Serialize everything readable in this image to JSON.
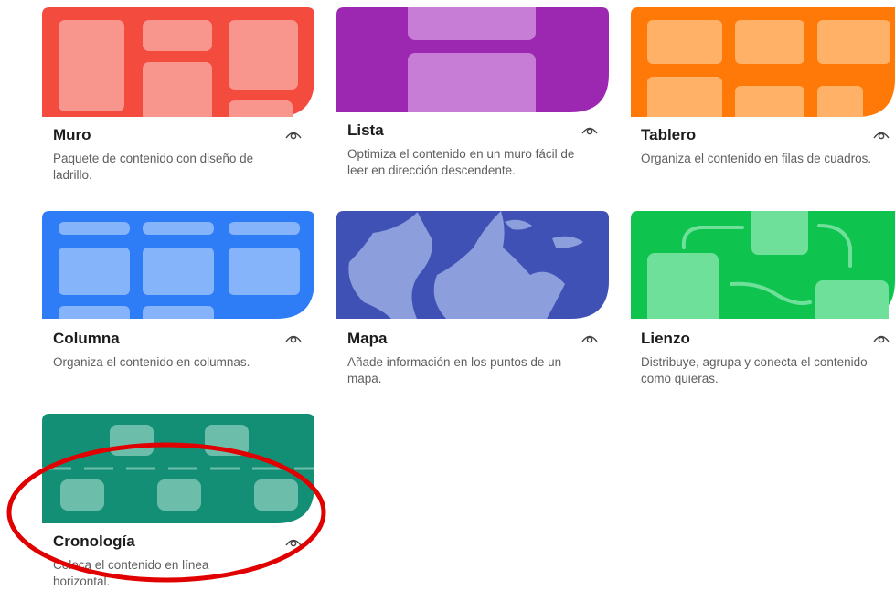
{
  "layouts": [
    {
      "key": "muro",
      "title": "Muro",
      "description": "Paquete de contenido con diseño de ladrillo.",
      "color": "#f44b3f",
      "icon": "eye-icon"
    },
    {
      "key": "lista",
      "title": "Lista",
      "description": "Optimiza el contenido en un muro fácil de leer en dirección descendente.",
      "color": "#9c27b0",
      "icon": "eye-icon"
    },
    {
      "key": "tablero",
      "title": "Tablero",
      "description": "Organiza el contenido en filas de cuadros.",
      "color": "#ff7908",
      "icon": "eye-icon"
    },
    {
      "key": "columna",
      "title": "Columna",
      "description": "Organiza el contenido en columnas.",
      "color": "#2e7cf6",
      "icon": "eye-icon"
    },
    {
      "key": "mapa",
      "title": "Mapa",
      "description": "Añade información en los puntos de un mapa.",
      "color": "#3f51b5",
      "icon": "eye-icon"
    },
    {
      "key": "lienzo",
      "title": "Lienzo",
      "description": "Distribuye, agrupa y conecta el contenido como quieras.",
      "color": "#0ec44f",
      "icon": "eye-icon"
    },
    {
      "key": "cronologia",
      "title": "Cronología",
      "description": "Coloca el contenido en línea horizontal.",
      "color": "#138f75",
      "icon": "eye-icon"
    }
  ],
  "annotation": {
    "shape": "ellipse",
    "color": "#e00000"
  }
}
